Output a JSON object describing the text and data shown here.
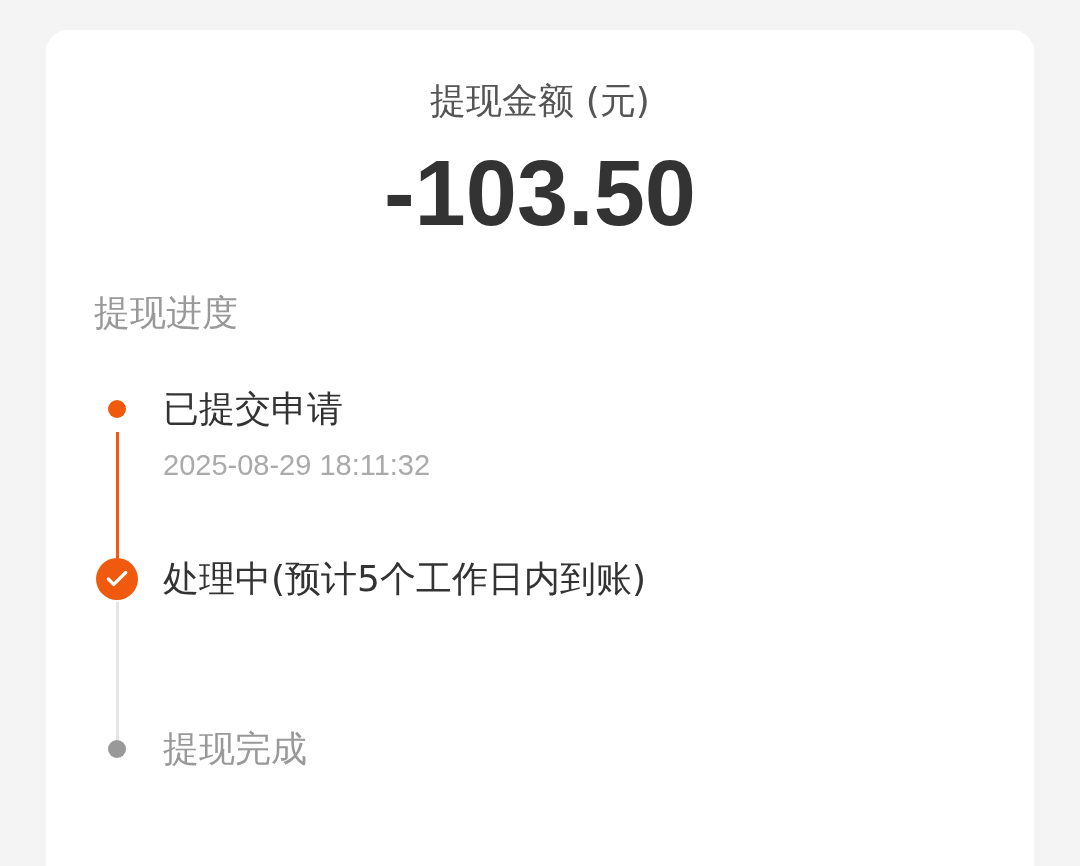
{
  "amount_label": "提现金额 (元)",
  "amount": "-103.50",
  "progress_title": "提现进度",
  "steps": [
    {
      "kind": "done",
      "title": "已提交申请",
      "time": "2025-08-29 18:11:32"
    },
    {
      "kind": "current",
      "title": "处理中(预计5个工作日内到账)"
    },
    {
      "kind": "pending",
      "title": "提现完成"
    }
  ]
}
